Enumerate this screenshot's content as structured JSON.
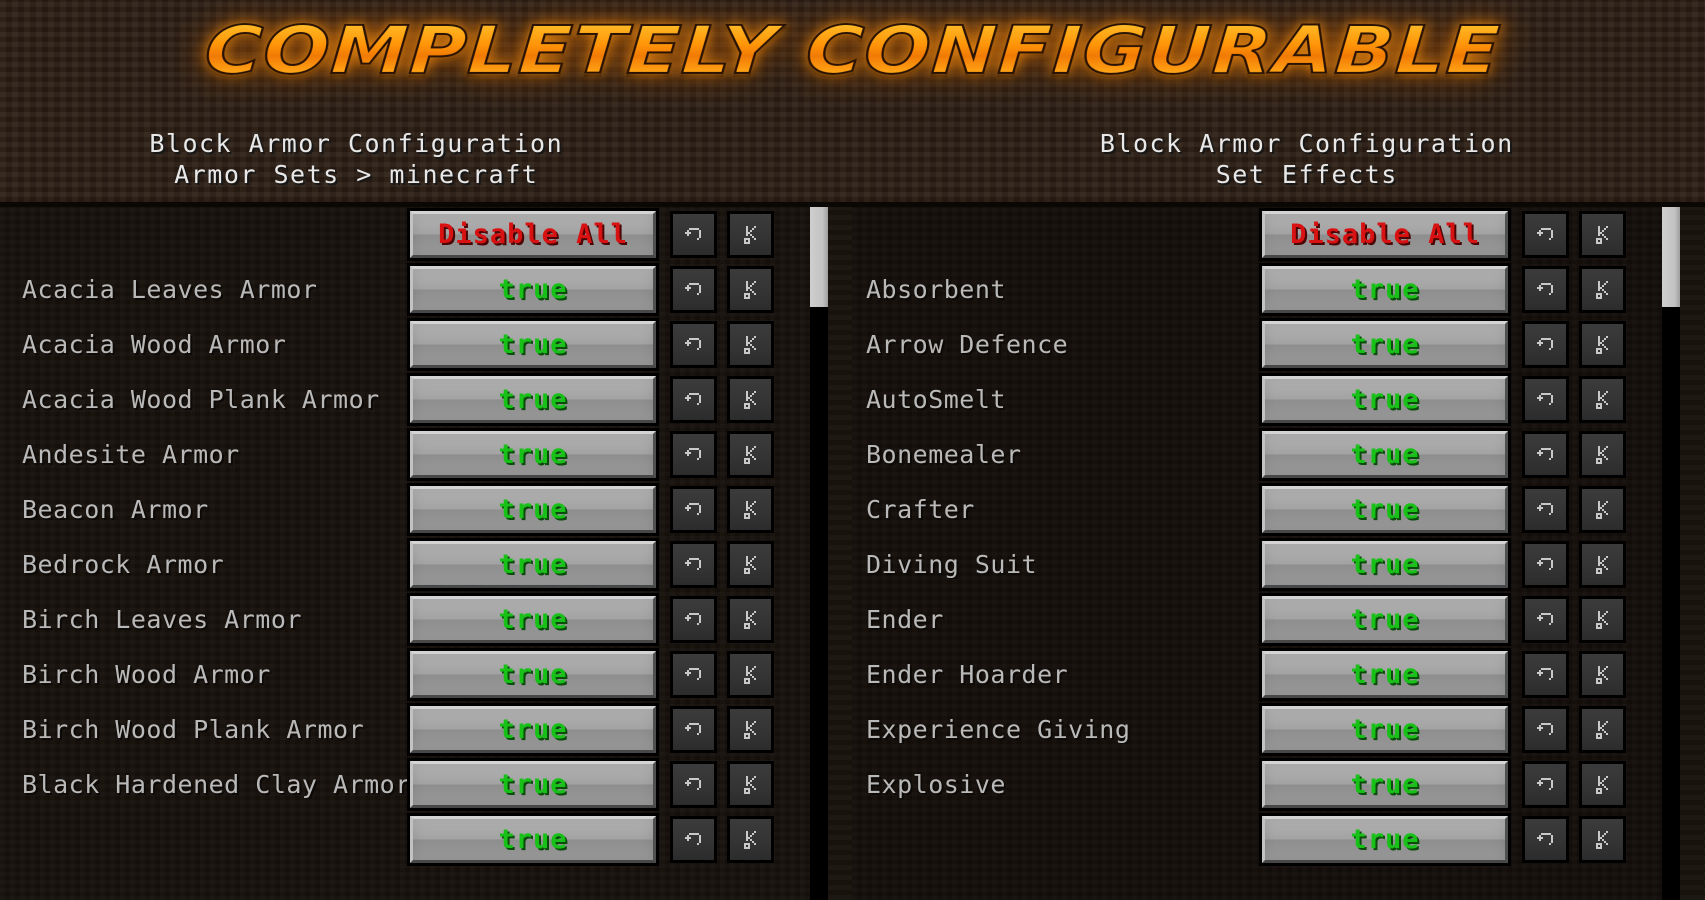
{
  "logo": {
    "text": "COMPLETELY CONFIGURABLE",
    "accent": "#ff9408",
    "stroke": "#2a1305"
  },
  "header": {
    "left": {
      "title": "Block Armor Configuration",
      "breadcrumb": "Armor Sets > minecraft"
    },
    "right": {
      "title": "Block Armor Configuration",
      "breadcrumb": "Set Effects"
    }
  },
  "colors": {
    "true_green": "#18c118",
    "disable_red": "#d81212",
    "label_gray": "#b9b9b9",
    "button_face": "#a3a3a3",
    "scroll_thumb": "#c2c2c2"
  },
  "icons": {
    "undo": "undo-arrow-icon",
    "cut": "scissors-icon"
  },
  "labels": {
    "value_true": "true",
    "disable_all": "Disable All"
  },
  "left_panel": {
    "name": "armor-sets-panel",
    "header_button": "Disable All",
    "scroll_thumb_top_pct": 0,
    "rows": [
      {
        "label": "Acacia Leaves Armor",
        "value": "true"
      },
      {
        "label": "Acacia Wood Armor",
        "value": "true"
      },
      {
        "label": "Acacia Wood Plank Armor",
        "value": "true"
      },
      {
        "label": "Andesite Armor",
        "value": "true"
      },
      {
        "label": "Beacon Armor",
        "value": "true"
      },
      {
        "label": "Bedrock Armor",
        "value": "true"
      },
      {
        "label": "Birch Leaves Armor",
        "value": "true"
      },
      {
        "label": "Birch Wood Armor",
        "value": "true"
      },
      {
        "label": "Birch Wood Plank Armor",
        "value": "true"
      },
      {
        "label": "Black Hardened Clay Armor",
        "value": "true"
      },
      {
        "label": "",
        "value": "true"
      }
    ]
  },
  "right_panel": {
    "name": "set-effects-panel",
    "header_button": "Disable All",
    "scroll_thumb_top_pct": 0,
    "rows": [
      {
        "label": "Absorbent",
        "value": "true"
      },
      {
        "label": "Arrow Defence",
        "value": "true"
      },
      {
        "label": "AutoSmelt",
        "value": "true"
      },
      {
        "label": "Bonemealer",
        "value": "true"
      },
      {
        "label": "Crafter",
        "value": "true"
      },
      {
        "label": "Diving Suit",
        "value": "true"
      },
      {
        "label": "Ender",
        "value": "true"
      },
      {
        "label": "Ender Hoarder",
        "value": "true"
      },
      {
        "label": "Experience Giving",
        "value": "true"
      },
      {
        "label": "Explosive",
        "value": "true"
      },
      {
        "label": "",
        "value": "true"
      }
    ]
  }
}
